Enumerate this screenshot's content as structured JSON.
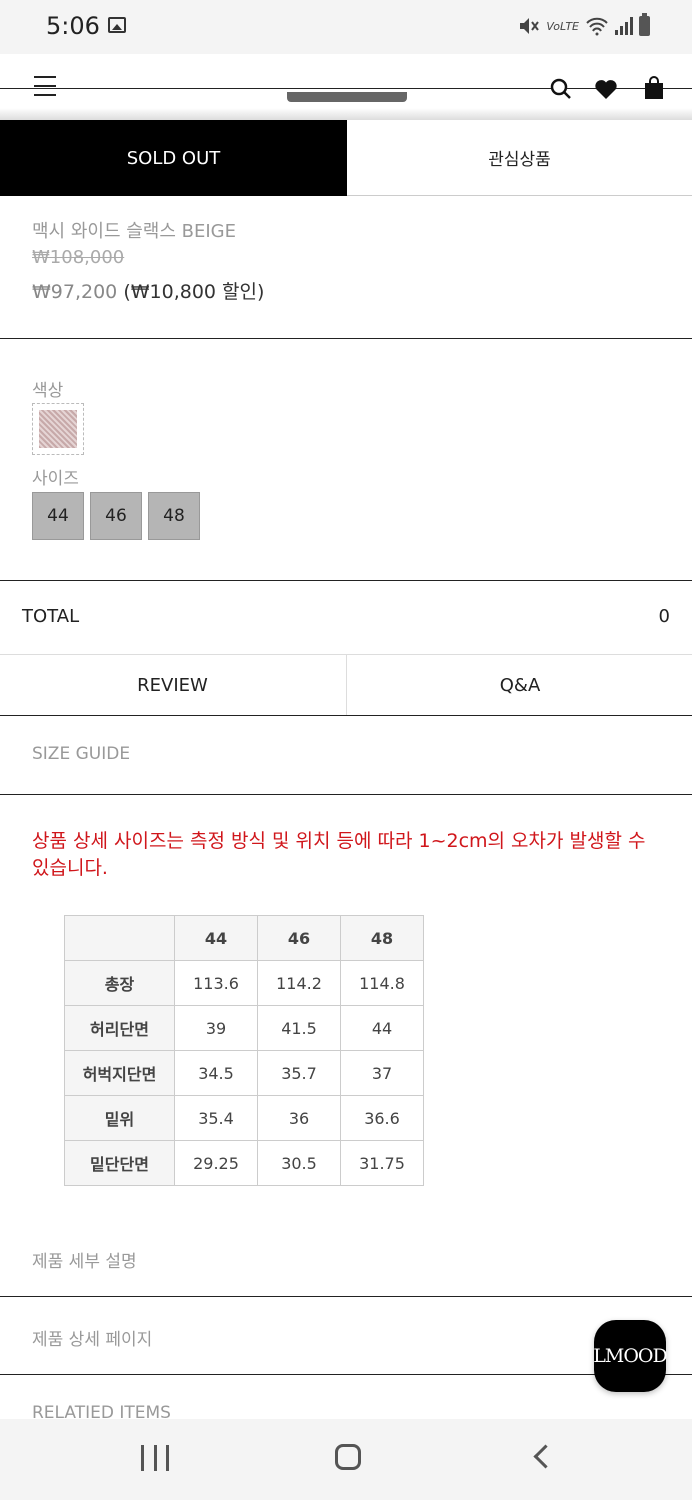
{
  "status_bar": {
    "time": "5:06",
    "network_label": "VoLTE"
  },
  "header": {
    "icons": [
      "menu-icon",
      "search-icon",
      "heart-icon",
      "shopping-bag-icon"
    ]
  },
  "actions": {
    "sold_out_label": "SOLD OUT",
    "wishlist_label": "관심상품"
  },
  "product": {
    "name": "맥시 와이드 슬랙스 BEIGE",
    "original_price": "₩108,000",
    "sale_price": "₩97,200",
    "discount": "(₩10,800 할인)"
  },
  "options": {
    "color_label": "색상",
    "size_label": "사이즈",
    "sizes": [
      "44",
      "46",
      "48"
    ]
  },
  "total": {
    "label": "TOTAL",
    "value": "0"
  },
  "tabs": {
    "review": "REVIEW",
    "qna": "Q&A"
  },
  "size_guide": {
    "label": "SIZE GUIDE",
    "notice": "상품 상세 사이즈는 측정 방식 및 위치 등에 따라 1~2cm의 오차가 발생할 수 있습니다.",
    "table": {
      "columns": [
        "44",
        "46",
        "48"
      ],
      "rows": [
        {
          "label": "총장",
          "values": [
            "113.6",
            "114.2",
            "114.8"
          ]
        },
        {
          "label": "허리단면",
          "values": [
            "39",
            "41.5",
            "44"
          ]
        },
        {
          "label": "허벅지단면",
          "values": [
            "34.5",
            "35.7",
            "37"
          ]
        },
        {
          "label": "밑위",
          "values": [
            "35.4",
            "36",
            "36.6"
          ]
        },
        {
          "label": "밑단단면",
          "values": [
            "29.25",
            "30.5",
            "31.75"
          ]
        }
      ]
    }
  },
  "sections": {
    "detail_description": "제품 세부 설명",
    "detail_page": "제품 상세 페이지",
    "related_items": "RELATIED ITEMS"
  },
  "floating_button": {
    "label": "LMOOD"
  },
  "colors": {
    "sold_out_bg": "#000000",
    "notice_red": "#d0161b",
    "size_btn_bg": "#b5b5b5"
  }
}
